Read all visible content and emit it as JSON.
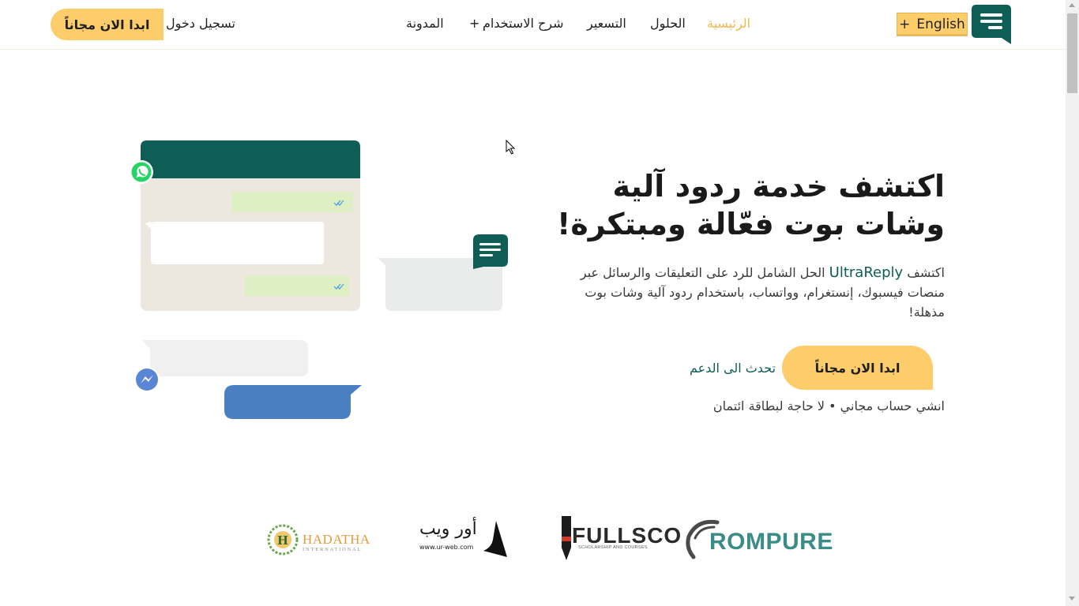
{
  "header": {
    "lang_button": "English",
    "lang_plus": "+",
    "nav": {
      "home": "الرئيسية",
      "solutions": "الحلول",
      "pricing": "التسعير",
      "how_to": "شرح الاستخدام",
      "how_to_plus": "+",
      "blog": "المدونة"
    },
    "login": "تسجيل دخول",
    "signup": "ابدا الان مجاناً"
  },
  "hero": {
    "title_line1": "اكتشف خدمة ردود آلية",
    "title_line2": "وشات بوت فعّالة ومبتكرة!",
    "desc_prefix": "اكتشف",
    "brand": "UltraReply",
    "desc_rest": "الحل الشامل للرد على التعليقات والرسائل عبر منصات فيسبوك، إنستغرام، وواتساب، باستخدام ردود آلية وشات بوت مذهلة!",
    "cta": "ابدا الان مجاناً",
    "support": "تحدث الى الدعم",
    "note": "انشي حساب مجاني • لا حاجة لبطاقة ائتمان"
  },
  "partners": {
    "hadatha_main": "HADATHA",
    "hadatha_sub": "INTERNATIONAL",
    "urweb_ar": "أور ويب",
    "urweb_url": "www.ur-web.com",
    "fullsco_main": "FULLSCO",
    "fullsco_sub": "SCHOLARSHIP AND COURSES",
    "rompure": "ROMPURE"
  },
  "colors": {
    "primary": "#0e5e55",
    "accent": "#fdcd6b",
    "whatsapp": "#25d366",
    "messenger": "#4a7fc1"
  },
  "icons": [
    "ultrareply-logo",
    "whatsapp-icon",
    "messenger-icon",
    "chat-bubble-icon",
    "double-check-icon",
    "mouse-cursor-icon"
  ]
}
